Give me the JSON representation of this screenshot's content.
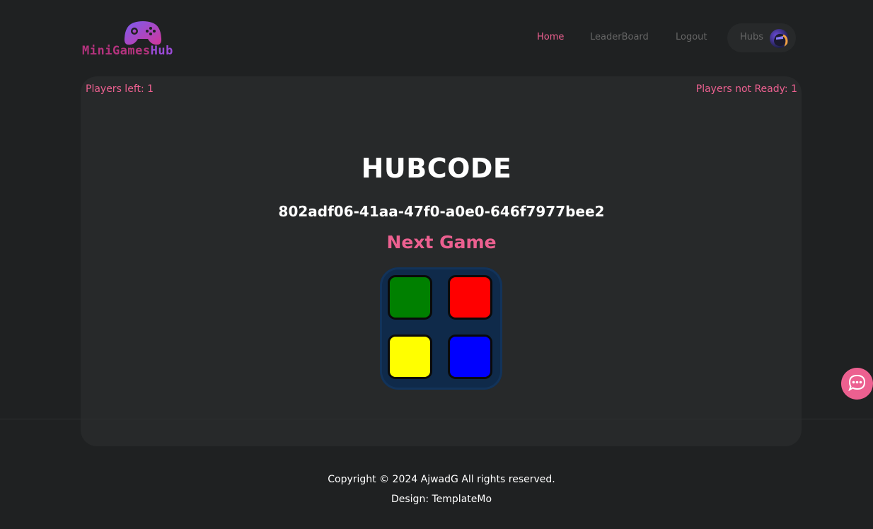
{
  "header": {
    "logo": {
      "text_main": "MiniGames",
      "text_accent": "Hub",
      "icon": "gamepad-icon"
    },
    "nav": {
      "home": "Home",
      "leaderboard": "LeaderBoard",
      "logout": "Logout",
      "hubs": "Hubs"
    },
    "avatar_icon": "user-avatar"
  },
  "status": {
    "players_left_label": "Players left:",
    "players_left_value": "1",
    "players_not_ready_label": "Players not Ready:",
    "players_not_ready_value": "1"
  },
  "hub": {
    "title": "HUBCODE",
    "code": "802adf06-41aa-47f0-a0e0-646f7977bee2",
    "next_game_label": "Next Game",
    "next_game_icon": "simon-says-game-icon"
  },
  "chat": {
    "icon": "chat-bubble-icon"
  },
  "footer": {
    "copyright": "Copyright © 2024 AjwadG All rights reserved.",
    "design": "Design: TemplateMo"
  },
  "colors": {
    "accent": "#ec6090",
    "background": "#1f2122",
    "card": "#27292a"
  }
}
